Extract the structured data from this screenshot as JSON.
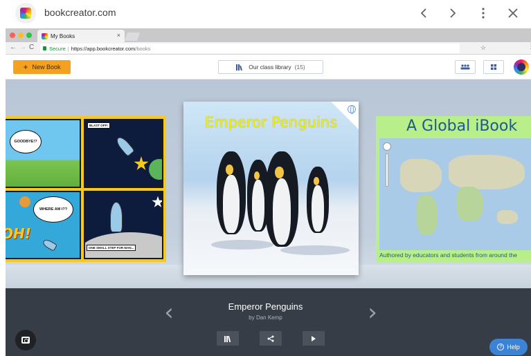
{
  "site": {
    "title": "bookcreator.com"
  },
  "browser": {
    "tab_title": "My Books",
    "tab_close": "×",
    "secure_label": "Secure",
    "url_host": "https://app.bookcreator.com",
    "url_path": "/books"
  },
  "header": {
    "new_book_label": "New Book",
    "library_label": "Our class library",
    "library_count": "(15)"
  },
  "books": {
    "left": {
      "bubbles": [
        "GOODBYE!?",
        "WHERE AM I??"
      ],
      "captions": [
        "BLAST OFF!",
        "ONE SMALL STEP FOR MAN..."
      ],
      "exclaim": "OH!"
    },
    "center": {
      "title": "Emperor Penguins"
    },
    "right": {
      "title": "A Global iBook",
      "subtitle": "Authored by educators and students from around the"
    }
  },
  "selected": {
    "title": "Emperor Penguins",
    "author": "by Dan Kemp"
  },
  "help_label": "Help",
  "colors": {
    "accent": "#f4a020",
    "help": "#3c83d6",
    "bottom_bar": "#373d46"
  }
}
